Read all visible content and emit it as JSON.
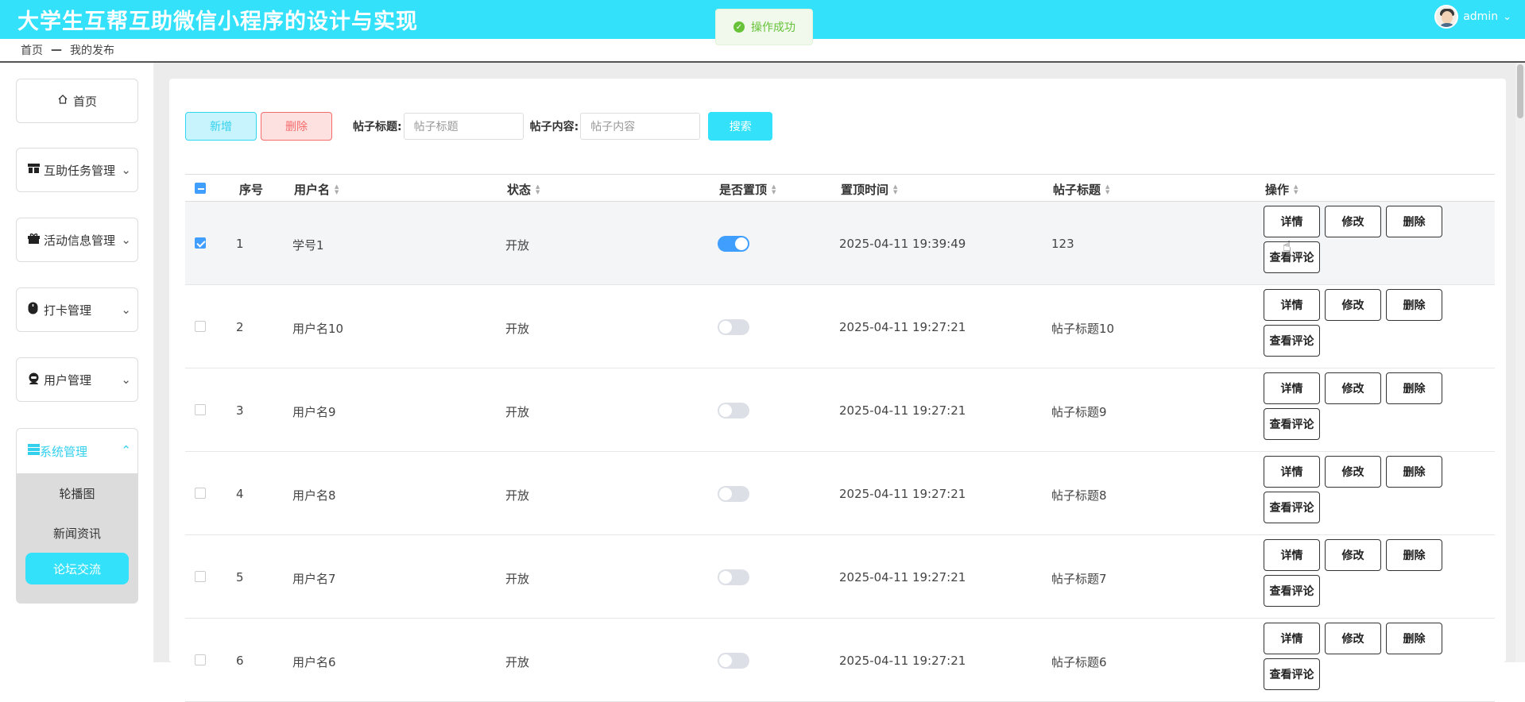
{
  "app": {
    "title": "大学生互帮互助微信小程序的设计与实现",
    "user": "admin"
  },
  "toast": {
    "message": "操作成功",
    "type": "success"
  },
  "breadcrumb": {
    "home": "首页",
    "current": "我的发布"
  },
  "sidebar": {
    "items": [
      {
        "label": "首页",
        "icon": "home-icon",
        "expandable": false
      },
      {
        "label": "互助任务管理",
        "icon": "task-icon",
        "expandable": true
      },
      {
        "label": "活动信息管理",
        "icon": "gift-icon",
        "expandable": true
      },
      {
        "label": "打卡管理",
        "icon": "mouse-icon",
        "expandable": true
      },
      {
        "label": "用户管理",
        "icon": "user-icon",
        "expandable": true
      }
    ],
    "open_group": {
      "label": "系统管理",
      "icon": "system-icon",
      "children": [
        {
          "label": "轮播图",
          "active": false
        },
        {
          "label": "新闻资讯",
          "active": false
        },
        {
          "label": "论坛交流",
          "active": true
        }
      ]
    }
  },
  "toolbar": {
    "add_label": "新增",
    "delete_label": "删除",
    "title_label": "帖子标题:",
    "title_placeholder": "帖子标题",
    "content_label": "帖子内容:",
    "content_placeholder": "帖子内容",
    "search_label": "搜索"
  },
  "table": {
    "columns": [
      "序号",
      "用户名",
      "状态",
      "是否置顶",
      "置顶时间",
      "帖子标题",
      "操作"
    ],
    "actions": [
      "详情",
      "修改",
      "删除",
      "查看评论"
    ],
    "rows": [
      {
        "index": "1",
        "username": "学号1",
        "status": "开放",
        "pinned": true,
        "pin_time": "2025-04-11 19:39:49",
        "title": "123",
        "selected": true
      },
      {
        "index": "2",
        "username": "用户名10",
        "status": "开放",
        "pinned": false,
        "pin_time": "2025-04-11 19:27:21",
        "title": "帖子标题10",
        "selected": false
      },
      {
        "index": "3",
        "username": "用户名9",
        "status": "开放",
        "pinned": false,
        "pin_time": "2025-04-11 19:27:21",
        "title": "帖子标题9",
        "selected": false
      },
      {
        "index": "4",
        "username": "用户名8",
        "status": "开放",
        "pinned": false,
        "pin_time": "2025-04-11 19:27:21",
        "title": "帖子标题8",
        "selected": false
      },
      {
        "index": "5",
        "username": "用户名7",
        "status": "开放",
        "pinned": false,
        "pin_time": "2025-04-11 19:27:21",
        "title": "帖子标题7",
        "selected": false
      },
      {
        "index": "6",
        "username": "用户名6",
        "status": "开放",
        "pinned": false,
        "pin_time": "2025-04-11 19:27:21",
        "title": "帖子标题6",
        "selected": false
      }
    ]
  },
  "colors": {
    "primary": "#33e1fb",
    "switch_on": "#409eff",
    "danger": "#f56c6c",
    "success": "#67c23a"
  }
}
